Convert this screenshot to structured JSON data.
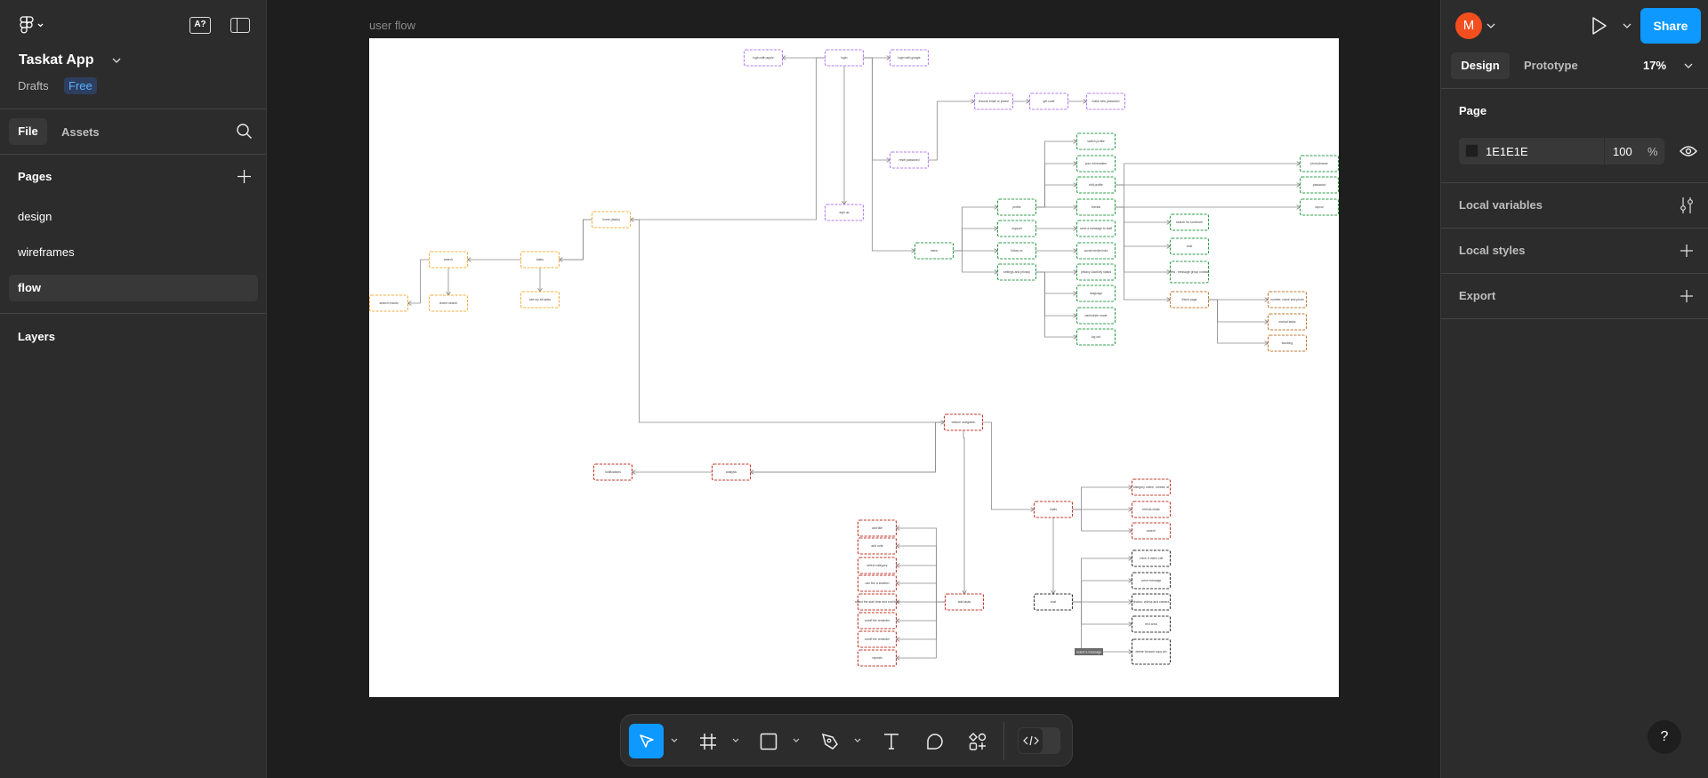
{
  "left_panel": {
    "file_name": "Taskat App",
    "location": "Drafts",
    "plan_badge": "Free",
    "tabs": [
      {
        "label": "File",
        "active": true
      },
      {
        "label": "Assets",
        "active": false
      }
    ],
    "pages_heading": "Pages",
    "pages": [
      {
        "label": "design"
      },
      {
        "label": "wireframes"
      },
      {
        "label": "flow",
        "selected": true
      }
    ],
    "layers_heading": "Layers",
    "icons": [
      "figma-logo-icon",
      "ai-icon",
      "sidebar-toggle-icon",
      "search-icon",
      "plus-icon"
    ]
  },
  "right_panel": {
    "avatar_letter": "M",
    "avatar_color": "#f24e1e",
    "share_label": "Share",
    "share_color": "#0d99ff",
    "tabs": [
      {
        "label": "Design",
        "active": true
      },
      {
        "label": "Prototype",
        "active": false
      }
    ],
    "zoom": "17%",
    "page_heading": "Page",
    "page_color": "1E1E1E",
    "page_opacity": "100",
    "percent": "%",
    "sections": [
      {
        "label": "Local variables",
        "icon": "sliders-icon"
      },
      {
        "label": "Local styles",
        "icon": "plus-icon"
      },
      {
        "label": "Export",
        "icon": "plus-icon"
      }
    ],
    "help_label": "?"
  },
  "canvas": {
    "frame_label": "user flow",
    "background": "#1e1e1e"
  },
  "toolbar": {
    "tools": [
      "move-tool",
      "frame-tool",
      "rectangle-tool",
      "pen-tool",
      "text-tool",
      "comment-tool",
      "actions-tool",
      "dev-mode-toggle"
    ],
    "active_tool": "move-tool"
  },
  "diagram": {
    "colors": {
      "purple": "#b57cf5",
      "green": "#2f9e4a",
      "orange": "#f5b042",
      "red": "#c0392b",
      "brown": "#c07a30",
      "dark": "#333333"
    },
    "nodes": [
      {
        "id": "apple",
        "label": "login with apple",
        "color": "purple"
      },
      {
        "id": "login",
        "label": "login",
        "color": "purple"
      },
      {
        "id": "google",
        "label": "login with google",
        "color": "purple"
      },
      {
        "id": "choose",
        "label": "choose email or phone",
        "color": "purple"
      },
      {
        "id": "code",
        "label": "get code",
        "color": "purple"
      },
      {
        "id": "newpw",
        "label": "make new password",
        "color": "purple"
      },
      {
        "id": "reset",
        "label": "reset password",
        "color": "purple"
      },
      {
        "id": "signup",
        "label": "sign up",
        "color": "purple"
      },
      {
        "id": "home",
        "label": "home (tasks)",
        "color": "orange"
      },
      {
        "id": "search",
        "label": "search",
        "color": "orange"
      },
      {
        "id": "tasks",
        "label": "tasks",
        "color": "orange"
      },
      {
        "id": "results",
        "label": "search results",
        "color": "orange"
      },
      {
        "id": "recent",
        "label": "recent search",
        "color": "orange"
      },
      {
        "id": "seeall",
        "label": "see my all tasks",
        "color": "orange"
      },
      {
        "id": "menu",
        "label": "menu",
        "color": "green"
      },
      {
        "id": "profile",
        "label": "profile",
        "color": "green"
      },
      {
        "id": "support",
        "label": "support",
        "color": "green"
      },
      {
        "id": "follow",
        "label": "follow us",
        "color": "green"
      },
      {
        "id": "settings",
        "label": "settings and privacy",
        "color": "green"
      },
      {
        "id": "switch",
        "label": "switch profile",
        "color": "green"
      },
      {
        "id": "info",
        "label": "your information",
        "color": "green"
      },
      {
        "id": "edit",
        "label": "edit profile",
        "color": "green"
      },
      {
        "id": "friends",
        "label": "friends",
        "color": "green"
      },
      {
        "id": "send",
        "label": "send a message to staff",
        "color": "green"
      },
      {
        "id": "social",
        "label": "social media links",
        "color": "green"
      },
      {
        "id": "privacy",
        "label": "privacy &activity status",
        "color": "green"
      },
      {
        "id": "language",
        "label": "language",
        "color": "green"
      },
      {
        "id": "dark",
        "label": "dark/white mode",
        "color": "green"
      },
      {
        "id": "logout",
        "label": "log out",
        "color": "green"
      },
      {
        "id": "photo",
        "label": "photo&name",
        "color": "green"
      },
      {
        "id": "password",
        "label": "password",
        "color": "green"
      },
      {
        "id": "layout",
        "label": "layout",
        "color": "green"
      },
      {
        "id": "someone",
        "label": "search for someone",
        "color": "green"
      },
      {
        "id": "fchat",
        "label": "chat",
        "color": "green"
      },
      {
        "id": "new",
        "label": "new : message group contact",
        "color": "green"
      },
      {
        "id": "fpage",
        "label": "friend page",
        "color": "brown"
      },
      {
        "id": "number",
        "label": "number, name and photo",
        "color": "brown"
      },
      {
        "id": "mutual",
        "label": "mutual tasks",
        "color": "brown"
      },
      {
        "id": "blocking",
        "label": "blocking",
        "color": "brown"
      },
      {
        "id": "bottomnav",
        "label": "bottom navigation",
        "color": "red"
      },
      {
        "id": "notif",
        "label": "notifications",
        "color": "red"
      },
      {
        "id": "analysis",
        "label": "analysis",
        "color": "red"
      },
      {
        "id": "addtasks",
        "label": "add tasks",
        "color": "red"
      },
      {
        "id": "t1",
        "label": "add title",
        "color": "red"
      },
      {
        "id": "t2",
        "label": "add note",
        "color": "red"
      },
      {
        "id": "t3",
        "label": "select category",
        "color": "red"
      },
      {
        "id": "t4",
        "label": "can link a location",
        "color": "red"
      },
      {
        "id": "t5",
        "label": "select the start time and end time",
        "color": "red"
      },
      {
        "id": "t6",
        "label": "on/off the reminder",
        "color": "red"
      },
      {
        "id": "t7",
        "label": "on/off the reminder",
        "color": "red"
      },
      {
        "id": "t8",
        "label": "repeats",
        "color": "red"
      },
      {
        "id": "chats",
        "label": "chats",
        "color": "red"
      },
      {
        "id": "category",
        "label": "category online, unread, at",
        "color": "red"
      },
      {
        "id": "fchats",
        "label": "friends chats",
        "color": "red"
      },
      {
        "id": "csearch",
        "label": "search",
        "color": "red"
      },
      {
        "id": "chat",
        "label": "chat",
        "color": "dark"
      },
      {
        "id": "call",
        "label": "voice & video call",
        "color": "dark"
      },
      {
        "id": "voice",
        "label": "voice message",
        "color": "dark"
      },
      {
        "id": "photos",
        "label": "photos, videos and camera",
        "color": "dark"
      },
      {
        "id": "text",
        "label": "text area",
        "color": "dark"
      },
      {
        "id": "delete",
        "label": "delete forward copy pin",
        "color": "dark"
      }
    ],
    "edge_label": "select a message",
    "edges": [
      [
        "login",
        "apple"
      ],
      [
        "login",
        "google"
      ],
      [
        "login",
        "signup"
      ],
      [
        "login",
        "reset"
      ],
      [
        "reset",
        "choose"
      ],
      [
        "choose",
        "code"
      ],
      [
        "code",
        "newpw"
      ],
      [
        "login",
        "home"
      ],
      [
        "home",
        "search"
      ],
      [
        "home",
        "tasks"
      ],
      [
        "search",
        "results"
      ],
      [
        "search",
        "recent"
      ],
      [
        "tasks",
        "seeall"
      ],
      [
        "login",
        "menu"
      ],
      [
        "menu",
        "profile"
      ],
      [
        "menu",
        "support"
      ],
      [
        "menu",
        "follow"
      ],
      [
        "menu",
        "settings"
      ],
      [
        "profile",
        "switch"
      ],
      [
        "profile",
        "info"
      ],
      [
        "profile",
        "edit"
      ],
      [
        "profile",
        "friends"
      ],
      [
        "support",
        "send"
      ],
      [
        "follow",
        "social"
      ],
      [
        "settings",
        "privacy"
      ],
      [
        "settings",
        "language"
      ],
      [
        "settings",
        "dark"
      ],
      [
        "settings",
        "logout"
      ],
      [
        "edit",
        "photo"
      ],
      [
        "edit",
        "password"
      ],
      [
        "edit",
        "layout"
      ],
      [
        "friends",
        "someone"
      ],
      [
        "friends",
        "fchat"
      ],
      [
        "friends",
        "new"
      ],
      [
        "friends",
        "fpage"
      ],
      [
        "fpage",
        "number"
      ],
      [
        "fpage",
        "mutual"
      ],
      [
        "fpage",
        "blocking"
      ],
      [
        "home",
        "bottomnav"
      ],
      [
        "bottomnav",
        "notif"
      ],
      [
        "bottomnav",
        "analysis"
      ],
      [
        "bottomnav",
        "addtasks"
      ],
      [
        "bottomnav",
        "chats"
      ],
      [
        "addtasks",
        "t1"
      ],
      [
        "addtasks",
        "t2"
      ],
      [
        "addtasks",
        "t3"
      ],
      [
        "addtasks",
        "t4"
      ],
      [
        "addtasks",
        "t5"
      ],
      [
        "addtasks",
        "t6"
      ],
      [
        "addtasks",
        "t7"
      ],
      [
        "addtasks",
        "t8"
      ],
      [
        "chats",
        "category"
      ],
      [
        "chats",
        "fchats"
      ],
      [
        "chats",
        "csearch"
      ],
      [
        "chats",
        "chat"
      ],
      [
        "chat",
        "call"
      ],
      [
        "chat",
        "voice"
      ],
      [
        "chat",
        "photos"
      ],
      [
        "chat",
        "text"
      ],
      [
        "chat",
        "delete"
      ]
    ]
  }
}
